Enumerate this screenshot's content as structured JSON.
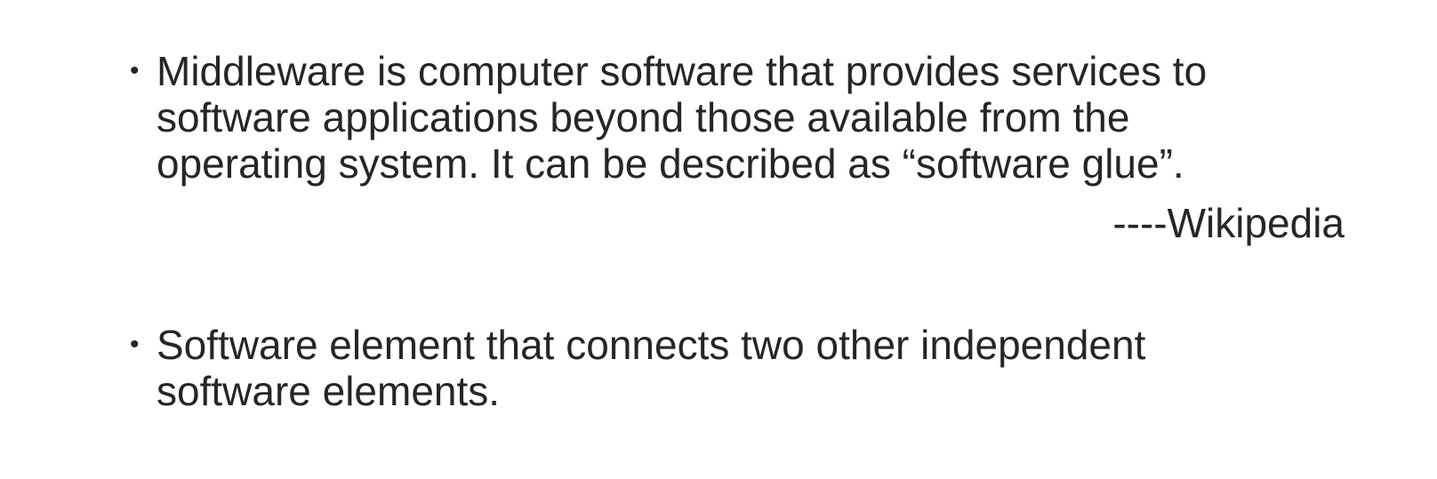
{
  "slide": {
    "bullet_symbol": "•",
    "bullets": [
      {
        "lines": [
          "Middleware is computer software that provides services to",
          "software applications beyond those available from the",
          "operating system. It can be described as “software glue”."
        ]
      },
      {
        "lines": [
          "Software element that connects two other independent",
          "software elements."
        ]
      }
    ],
    "attribution": "----Wikipedia"
  }
}
